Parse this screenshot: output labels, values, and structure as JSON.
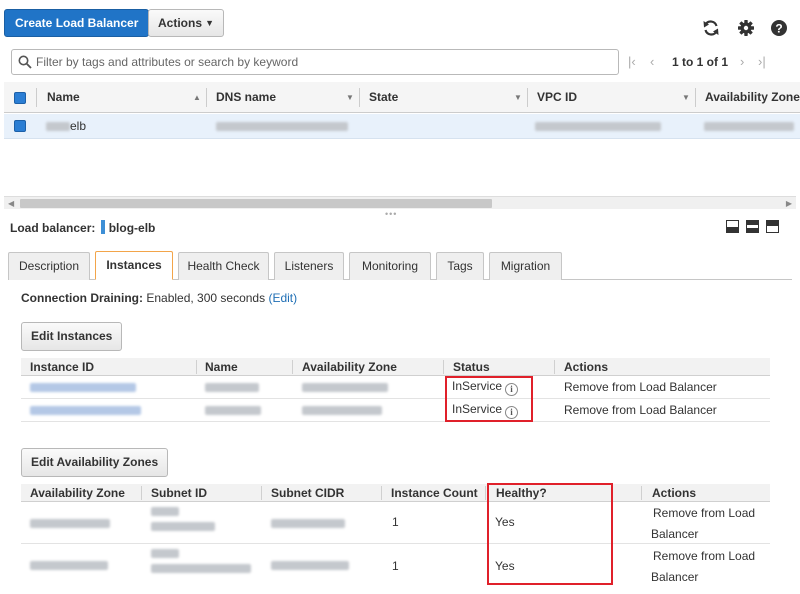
{
  "toolbar": {
    "create_label": "Create Load Balancer",
    "actions_label": "Actions",
    "refresh_icon": "refresh-icon",
    "settings_icon": "gear-icon",
    "help_icon": "help-icon"
  },
  "filter": {
    "placeholder": "Filter by tags and attributes or search by keyword",
    "pagination_text": "1 to 1 of 1"
  },
  "main_table": {
    "columns": [
      "Name",
      "DNS name",
      "State",
      "VPC ID",
      "Availability Zone"
    ],
    "row": {
      "name_suffix": "elb"
    }
  },
  "detail": {
    "label": "Load balancer:",
    "selected_name": "blog-elb",
    "tabs": [
      "Description",
      "Instances",
      "Health Check",
      "Listeners",
      "Monitoring",
      "Tags",
      "Migration"
    ],
    "active_tab": "Instances",
    "draining_label": "Connection Draining:",
    "draining_value": "Enabled, 300 seconds",
    "draining_edit": "(Edit)"
  },
  "instances": {
    "edit_button": "Edit Instances",
    "columns": [
      "Instance ID",
      "Name",
      "Availability Zone",
      "Status",
      "Actions"
    ],
    "rows": [
      {
        "status": "InService",
        "action": "Remove from Load Balancer"
      },
      {
        "status": "InService",
        "action": "Remove from Load Balancer"
      }
    ]
  },
  "zones": {
    "edit_button": "Edit Availability Zones",
    "columns": [
      "Availability Zone",
      "Subnet ID",
      "Subnet CIDR",
      "Instance Count",
      "Healthy?",
      "Actions"
    ],
    "rows": [
      {
        "count": "1",
        "healthy": "Yes",
        "action_line1": "Remove from Load",
        "action_line2": "Balancer"
      },
      {
        "count": "1",
        "healthy": "Yes",
        "action_line1": "Remove from Load",
        "action_line2": "Balancer"
      }
    ]
  },
  "colors": {
    "primary": "#2074c7",
    "link": "#1f6fb5",
    "highlight": "#e0202a",
    "active_tab_border": "#f3a54a"
  }
}
